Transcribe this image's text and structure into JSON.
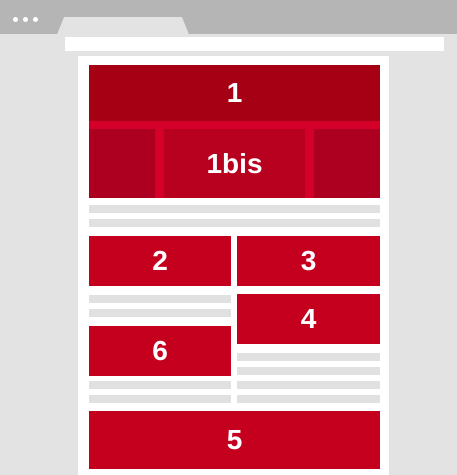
{
  "blocks": {
    "b1": "1",
    "b1bis": "1bis",
    "b2": "2",
    "b3": "3",
    "b4": "4",
    "b5": "5",
    "b6": "6"
  },
  "colors": {
    "block_red": "#c4001e",
    "header_dark_red": "#a50014",
    "carousel_red": "#d4002a",
    "placeholder_gray": "#e1e1e1",
    "browser_gray": "#b5b5b5"
  }
}
